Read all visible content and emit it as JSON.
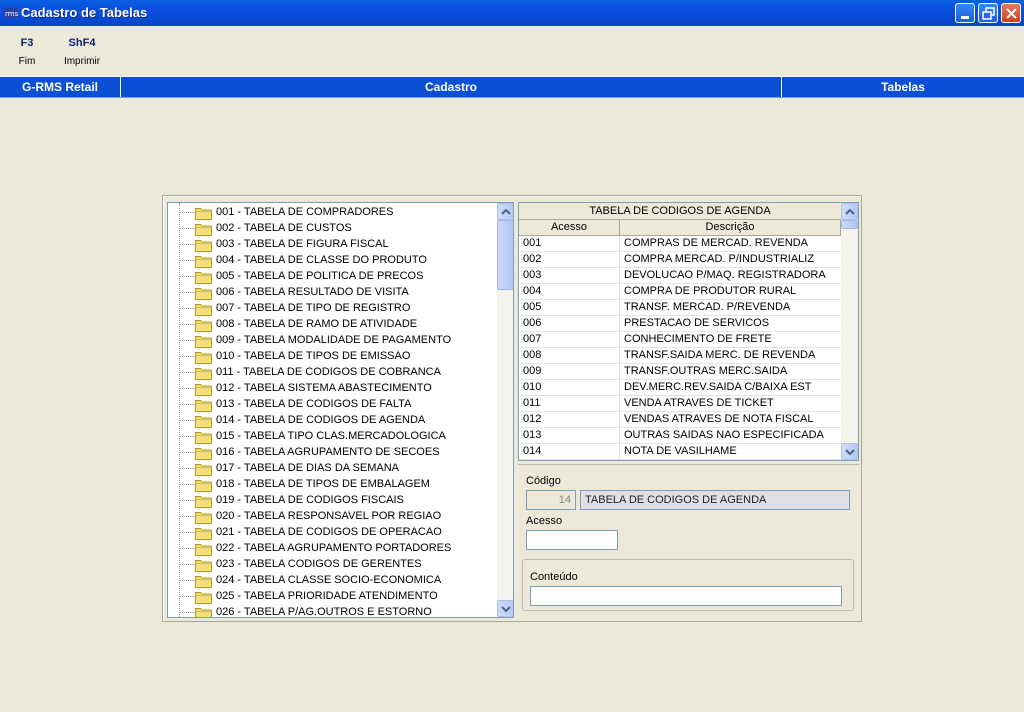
{
  "window": {
    "title": "Cadastro de Tabelas"
  },
  "fkeys": [
    {
      "key": "F3",
      "label": "Fim"
    },
    {
      "key": "ShF4",
      "label": "Imprimir"
    }
  ],
  "header": {
    "left": "G-RMS Retail",
    "center": "Cadastro",
    "right": "Tabelas"
  },
  "tree": {
    "items": [
      "001 - TABELA DE COMPRADORES",
      "002 - TABELA DE CUSTOS",
      "003 - TABELA DE FIGURA FISCAL",
      "004 - TABELA DE CLASSE DO PRODUTO",
      "005 - TABELA DE POLITICA DE PRECOS",
      "006 - TABELA RESULTADO DE VISITA",
      "007 - TABELA DE TIPO DE REGISTRO",
      "008 - TABELA DE RAMO DE ATIVIDADE",
      "009 - TABELA MODALIDADE DE PAGAMENTO",
      "010 - TABELA DE TIPOS DE EMISSAO",
      "011 - TABELA DE CODIGOS DE COBRANCA",
      "012 - TABELA SISTEMA ABASTECIMENTO",
      "013 - TABELA DE CODIGOS DE FALTA",
      "014 - TABELA DE CODIGOS DE AGENDA",
      "015 - TABELA TIPO CLAS.MERCADOLOGICA",
      "016 - TABELA AGRUPAMENTO DE SECOES",
      "017 - TABELA DE DIAS DA SEMANA",
      "018 - TABELA DE TIPOS DE EMBALAGEM",
      "019 - TABELA DE CODIGOS FISCAIS",
      "020 - TABELA RESPONSAVEL POR REGIAO",
      "021 - TABELA DE CODIGOS DE OPERACAO",
      "022 - TABELA AGRUPAMENTO PORTADORES",
      "023 - TABELA CODIGOS DE GERENTES",
      "024 - TABELA CLASSE SOCIO-ECONOMICA",
      "025 - TABELA PRIORIDADE ATENDIMENTO",
      "026 - TABELA P/AG.OUTROS E ESTORNO"
    ]
  },
  "grid": {
    "caption": "TABELA DE CODIGOS DE AGENDA",
    "columns": [
      "Acesso",
      "Descrição"
    ],
    "rows": [
      [
        "001",
        "COMPRAS DE MERCAD. REVENDA"
      ],
      [
        "002",
        "COMPRA MERCAD. P/INDUSTRIALIZ"
      ],
      [
        "003",
        "DEVOLUCAO P/MAQ. REGISTRADORA"
      ],
      [
        "004",
        "COMPRA DE PRODUTOR RURAL"
      ],
      [
        "005",
        "TRANSF. MERCAD. P/REVENDA"
      ],
      [
        "006",
        "PRESTACAO DE SERVICOS"
      ],
      [
        "007",
        "CONHECIMENTO DE FRETE"
      ],
      [
        "008",
        "TRANSF.SAIDA MERC. DE REVENDA"
      ],
      [
        "009",
        "TRANSF.OUTRAS MERC.SAIDA"
      ],
      [
        "010",
        "DEV.MERC.REV.SAIDA C/BAIXA EST"
      ],
      [
        "011",
        "VENDA ATRAVES DE TICKET"
      ],
      [
        "012",
        "VENDAS ATRAVES DE NOTA FISCAL"
      ],
      [
        "013",
        "OUTRAS SAIDAS NAO ESPECIFICADA"
      ],
      [
        "014",
        "NOTA DE VASILHAME"
      ]
    ]
  },
  "form": {
    "codigo_label": "Código",
    "codigo_value": "14",
    "codigo_desc": "TABELA DE CODIGOS DE AGENDA",
    "acesso_label": "Acesso",
    "acesso_value": "",
    "conteudo_label": "Conteúdo",
    "conteudo_value": ""
  },
  "icons": {
    "app": "app-icon",
    "minimize": "minimize-icon",
    "restore": "restore-icon",
    "close": "close-icon",
    "folder": "folder-icon"
  },
  "colors": {
    "titlebar": "#0a4ee0",
    "headerbar": "#0a4fd4",
    "window_bg": "#ece9d8",
    "folder": "#f4e07a"
  }
}
